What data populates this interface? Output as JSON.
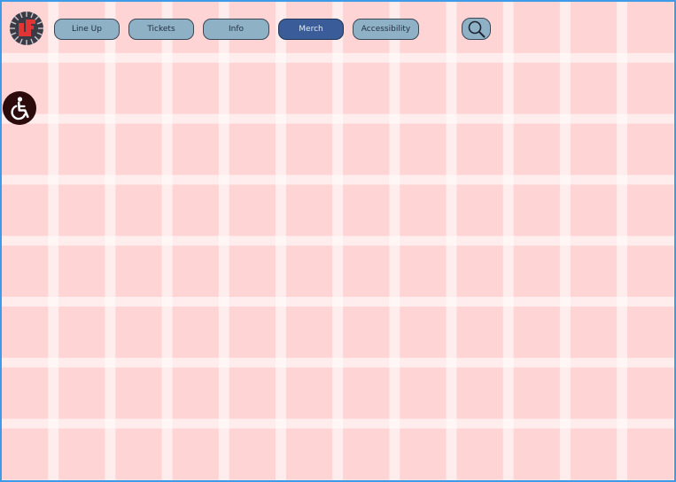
{
  "nav": {
    "items": [
      {
        "label": "Line Up",
        "active": false
      },
      {
        "label": "Tickets",
        "active": false
      },
      {
        "label": "Info",
        "active": false
      },
      {
        "label": "Merch",
        "active": true
      },
      {
        "label": "Accessibility",
        "active": false
      }
    ]
  },
  "icons": {
    "logo": "festival-logo-icon",
    "search": "search-icon",
    "accessibility": "wheelchair-icon"
  },
  "colors": {
    "background": "#ffd4d4",
    "frame": "#3d9be9",
    "nav_button": "#8eb1c6",
    "nav_button_active": "#3a5c98",
    "accessibility_button": "#2b0b0c",
    "logo_accent": "#e03535"
  }
}
